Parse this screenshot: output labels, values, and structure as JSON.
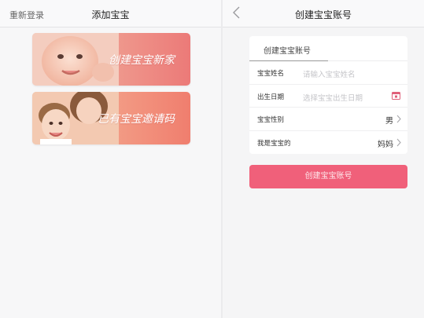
{
  "left_screen": {
    "nav": {
      "left_link": "重新登录",
      "title": "添加宝宝"
    },
    "cards": [
      {
        "label": "创建宝宝新家",
        "icon": "baby-photo"
      },
      {
        "label": "已有宝宝邀请码",
        "icon": "mother-child-photo"
      }
    ]
  },
  "right_screen": {
    "nav": {
      "back_icon": "chevron-left-icon",
      "title": "创建宝宝账号"
    },
    "form": {
      "header": "创建宝宝账号",
      "rows": [
        {
          "label": "宝宝姓名",
          "placeholder": "请输入宝宝姓名"
        },
        {
          "label": "出生日期",
          "placeholder": "选择宝宝出生日期",
          "icon": "calendar-icon"
        },
        {
          "label": "宝宝性别",
          "value": "男"
        },
        {
          "label": "我是宝宝的",
          "value": "妈妈"
        }
      ]
    },
    "submit_label": "创建宝宝账号"
  },
  "colors": {
    "accent": "#f0607a",
    "card_gradient_end": "#ec7a78"
  }
}
